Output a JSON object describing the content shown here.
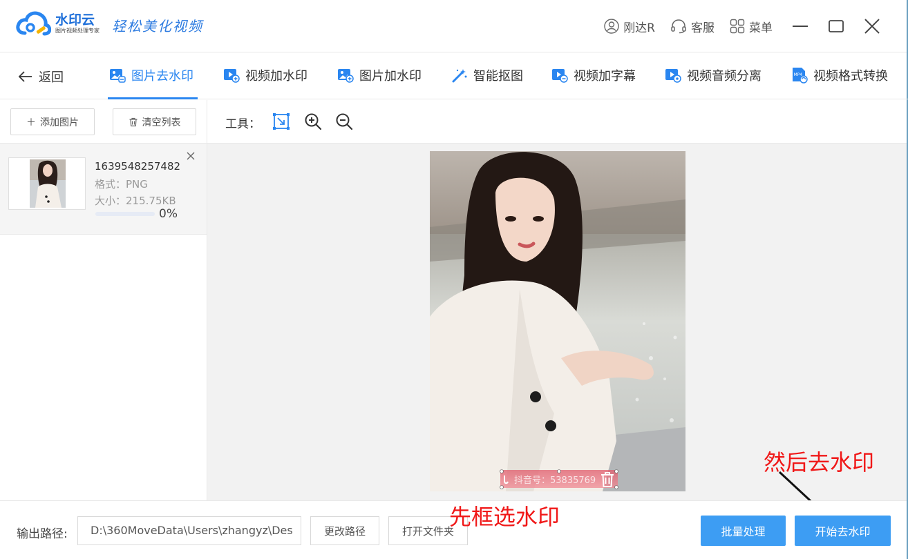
{
  "app": {
    "name": "水印云",
    "subtitle": "图片视频处理专家",
    "slogan": "轻松美化视频"
  },
  "titlebar": {
    "user_label": "刚达R",
    "service_label": "客服",
    "menu_label": "菜单"
  },
  "nav": {
    "back_label": "返回",
    "tabs": [
      {
        "label": "图片去水印",
        "icon": "image-remove-icon",
        "active": true
      },
      {
        "label": "视频加水印",
        "icon": "video-add-icon",
        "active": false
      },
      {
        "label": "图片加水印",
        "icon": "image-add-icon",
        "active": false
      },
      {
        "label": "智能抠图",
        "icon": "magic-wand-icon",
        "active": false
      },
      {
        "label": "视频加字幕",
        "icon": "video-subtitle-icon",
        "active": false
      },
      {
        "label": "视频音频分离",
        "icon": "video-audio-icon",
        "active": false
      },
      {
        "label": "视频格式转换",
        "icon": "mp4-file-icon",
        "active": false
      }
    ]
  },
  "sidebar": {
    "add_label": "添加图片",
    "clear_label": "清空列表",
    "file": {
      "name": "1639548257482",
      "format": "格式：PNG",
      "size": "大小：215.75KB",
      "progress": 0,
      "progress_label": "0%"
    }
  },
  "toolbar": {
    "label": "工具："
  },
  "canvas": {
    "watermark_text": "抖音号：53835769"
  },
  "annotations": {
    "select_hint": "先框选水印",
    "then_hint": "然后去水印"
  },
  "bottom": {
    "output_label": "输出路径:",
    "output_path": "D:\\360MoveData\\Users\\zhangyz\\Des",
    "change_path_label": "更改路径",
    "open_folder_label": "打开文件夹",
    "batch_label": "批量处理",
    "start_label": "开始去水印"
  },
  "colors": {
    "accent": "#2a86f0",
    "primary_button": "#3d9df3",
    "annotation": "#f01818"
  }
}
